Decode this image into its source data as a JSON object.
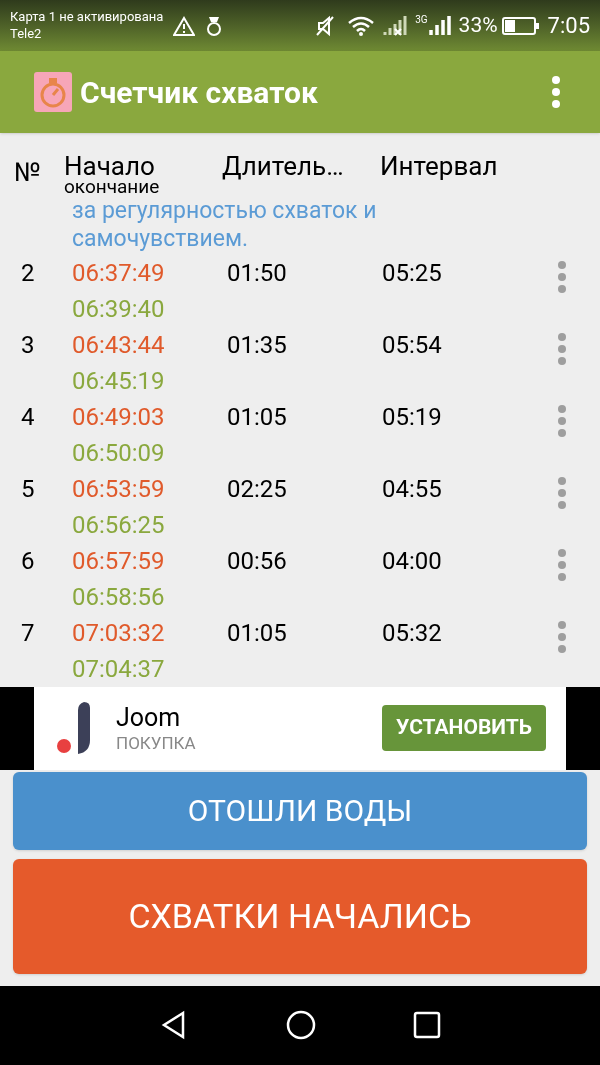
{
  "status_bar": {
    "sim_status": "Карта 1 не активирована",
    "carrier": "Tele2",
    "network": "3G",
    "battery": "33%",
    "time": "7:05"
  },
  "app_bar": {
    "title": "Счетчик схваток"
  },
  "table": {
    "columns": [
      {
        "label": "№"
      },
      {
        "label": "Начало",
        "sublabel": "окончание"
      },
      {
        "label": "Длитель…"
      },
      {
        "label": "Интервал"
      }
    ],
    "note": [
      "за регулярностью схваток и",
      "самочувствием."
    ],
    "rows": [
      {
        "number": "2",
        "start": "06:37:49",
        "end": "06:39:40",
        "duration": "01:50",
        "interval": "05:25"
      },
      {
        "number": "3",
        "start": "06:43:44",
        "end": "06:45:19",
        "duration": "01:35",
        "interval": "05:54"
      },
      {
        "number": "4",
        "start": "06:49:03",
        "end": "06:50:09",
        "duration": "01:05",
        "interval": "05:19"
      },
      {
        "number": "5",
        "start": "06:53:59",
        "end": "06:56:25",
        "duration": "02:25",
        "interval": "04:55"
      },
      {
        "number": "6",
        "start": "06:57:59",
        "end": "06:58:56",
        "duration": "00:56",
        "interval": "04:00"
      },
      {
        "number": "7",
        "start": "07:03:32",
        "end": "07:04:37",
        "duration": "01:05",
        "interval": "05:32"
      }
    ]
  },
  "ad": {
    "title": "Joom",
    "category": "ПОКУПКА",
    "button": "УСТАНОВИТЬ"
  },
  "buttons": [
    {
      "label": "ОТОШЛИ ВОДЫ",
      "kind": "water"
    },
    {
      "label": "СХВАТКИ НАЧАЛИСЬ",
      "kind": "contractions"
    }
  ]
}
